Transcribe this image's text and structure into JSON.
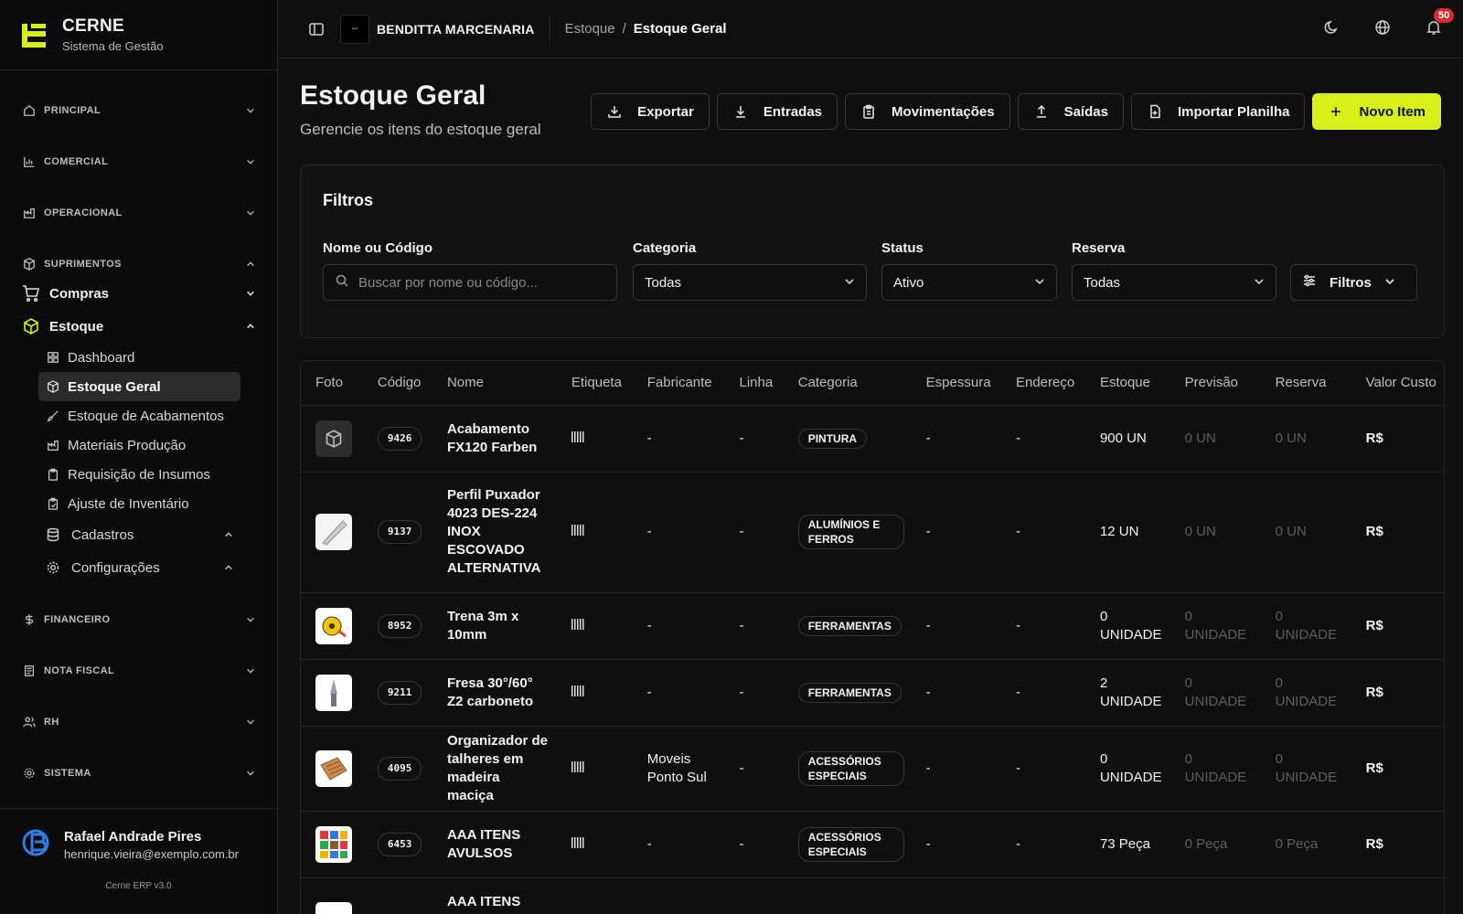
{
  "sidebar": {
    "brand_title": "CERNE",
    "brand_subtitle": "Sistema de Gestão",
    "sections": {
      "principal": "PRINCIPAL",
      "comercial": "COMERCIAL",
      "operacional": "OPERACIONAL",
      "suprimentos": "SUPRIMENTOS",
      "financeiro": "FINANCEIRO",
      "nota_fiscal": "NOTA FISCAL",
      "rh": "RH",
      "sistema": "SISTEMA"
    },
    "compras": "Compras",
    "estoque": "Estoque",
    "estoque_items": [
      "Dashboard",
      "Estoque Geral",
      "Estoque de Acabamentos",
      "Materiais Produção",
      "Requisição de Insumos",
      "Ajuste de Inventário"
    ],
    "cadastros": "Cadastros",
    "configuracoes": "Configurações",
    "user_name": "Rafael Andrade Pires",
    "user_email": "henrique.vieira@exemplo.com.br",
    "version": "Cerne ERP v3.0"
  },
  "topbar": {
    "company_name": "BENDITTA MARCENARIA",
    "breadcrumb_parent": "Estoque",
    "breadcrumb_sep": "/",
    "breadcrumb_current": "Estoque Geral",
    "notifications": "50"
  },
  "page": {
    "title": "Estoque Geral",
    "subtitle": "Gerencie os itens do estoque geral"
  },
  "actions": {
    "exportar": "Exportar",
    "entradas": "Entradas",
    "movimentacoes": "Movimentações",
    "saidas": "Saídas",
    "importar": "Importar Planilha",
    "novo": "Novo Item"
  },
  "filters": {
    "title": "Filtros",
    "name_label": "Nome ou Código",
    "name_placeholder": "Buscar por nome ou código...",
    "category_label": "Categoria",
    "category_value": "Todas",
    "status_label": "Status",
    "status_value": "Ativo",
    "reserve_label": "Reserva",
    "reserve_value": "Todas",
    "more_button": "Filtros"
  },
  "table": {
    "columns": [
      "Foto",
      "Código",
      "Nome",
      "Etiqueta",
      "Fabricante",
      "Linha",
      "Categoria",
      "Espessura",
      "Endereço",
      "Estoque",
      "Previsão",
      "Reserva",
      "Valor Custo"
    ],
    "rows": [
      {
        "code": "9426",
        "name": "Acabamento FX120 Farben",
        "fabricante": "-",
        "linha": "-",
        "categoria": "PINTURA",
        "espessura": "-",
        "endereco": "-",
        "estoque": "900 UN",
        "previsao": "0 UN",
        "reserva": "0 UN",
        "valor": "R$"
      },
      {
        "code": "9137",
        "name": "Perfil Puxador 4023 DES-224 INOX ESCOVADO ALTERNATIVA",
        "fabricante": "-",
        "linha": "-",
        "categoria": "ALUMÍNIOS E FERROS",
        "espessura": "-",
        "endereco": "-",
        "estoque": "12 UN",
        "previsao": "0 UN",
        "reserva": "0 UN",
        "valor": "R$"
      },
      {
        "code": "8952",
        "name": "Trena 3m x 10mm",
        "fabricante": "-",
        "linha": "-",
        "categoria": "FERRAMENTAS",
        "espessura": "-",
        "endereco": "-",
        "estoque": "0 UNIDADE",
        "previsao": "0 UNIDADE",
        "reserva": "0 UNIDADE",
        "valor": "R$"
      },
      {
        "code": "9211",
        "name": "Fresa 30°/60° Z2 carboneto",
        "fabricante": "-",
        "linha": "-",
        "categoria": "FERRAMENTAS",
        "espessura": "-",
        "endereco": "-",
        "estoque": "2 UNIDADE",
        "previsao": "0 UNIDADE",
        "reserva": "0 UNIDADE",
        "valor": "R$"
      },
      {
        "code": "4095",
        "name": "Organizador de talheres em madeira maciça",
        "fabricante": "Moveis Ponto Sul",
        "linha": "-",
        "categoria": "ACESSÓRIOS ESPECIAIS",
        "espessura": "-",
        "endereco": "-",
        "estoque": "0 UNIDADE",
        "previsao": "0 UNIDADE",
        "reserva": "0 UNIDADE",
        "valor": "R$"
      },
      {
        "code": "6453",
        "name": "AAA ITENS AVULSOS",
        "fabricante": "-",
        "linha": "-",
        "categoria": "ACESSÓRIOS ESPECIAIS",
        "espessura": "-",
        "endereco": "-",
        "estoque": "73 Peça",
        "previsao": "0 Peça",
        "reserva": "0 Peça",
        "valor": "R$"
      },
      {
        "code": "",
        "name": "AAA ITENS",
        "fabricante": "",
        "linha": "",
        "categoria": "",
        "espessura": "",
        "endereco": "",
        "estoque": "",
        "previsao": "",
        "reserva": "",
        "valor": ""
      }
    ]
  },
  "colors": {
    "accent": "#d8f01a",
    "badge": "#d92d2d",
    "background": "#0f0f0f"
  }
}
